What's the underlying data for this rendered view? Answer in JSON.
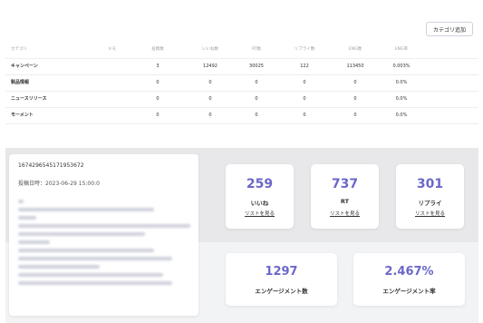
{
  "toolbar": {
    "add_category_label": "カテゴリ追加"
  },
  "table": {
    "headers": [
      "カテゴリ",
      "メモ",
      "投稿数",
      "いいね数",
      "RT数",
      "リプライ数",
      "ENG数",
      "ENG率"
    ],
    "rows": [
      [
        "キャンペーン",
        "",
        "3",
        "12492",
        "30025",
        "122",
        "113450",
        "0.003%"
      ],
      [
        "製品情報",
        "",
        "0",
        "0",
        "0",
        "0",
        "0",
        "0.0%"
      ],
      [
        "ニュースリリース",
        "",
        "0",
        "0",
        "0",
        "0",
        "0",
        "0.0%"
      ],
      [
        "モーメント",
        "",
        "0",
        "0",
        "0",
        "0",
        "0",
        "0.0%"
      ]
    ]
  },
  "post": {
    "id": "1674296545171953672",
    "date_label": "投稿日時：2023-06-29 15:00:0"
  },
  "metrics": {
    "likes": {
      "value": "259",
      "label": "いいね",
      "link": "リストを見る"
    },
    "retweets": {
      "value": "737",
      "label": "RT",
      "link": "リストを見る"
    },
    "replies": {
      "value": "301",
      "label": "リプライ",
      "link": "リストを見る"
    },
    "engagements": {
      "value": "1297",
      "label": "エンゲージメント数"
    },
    "engagement_rate": {
      "value": "2.467%",
      "label": "エンゲージメント率"
    }
  },
  "colors": {
    "accent": "#6b67c9",
    "panel_bg": "#e8e8ea"
  }
}
